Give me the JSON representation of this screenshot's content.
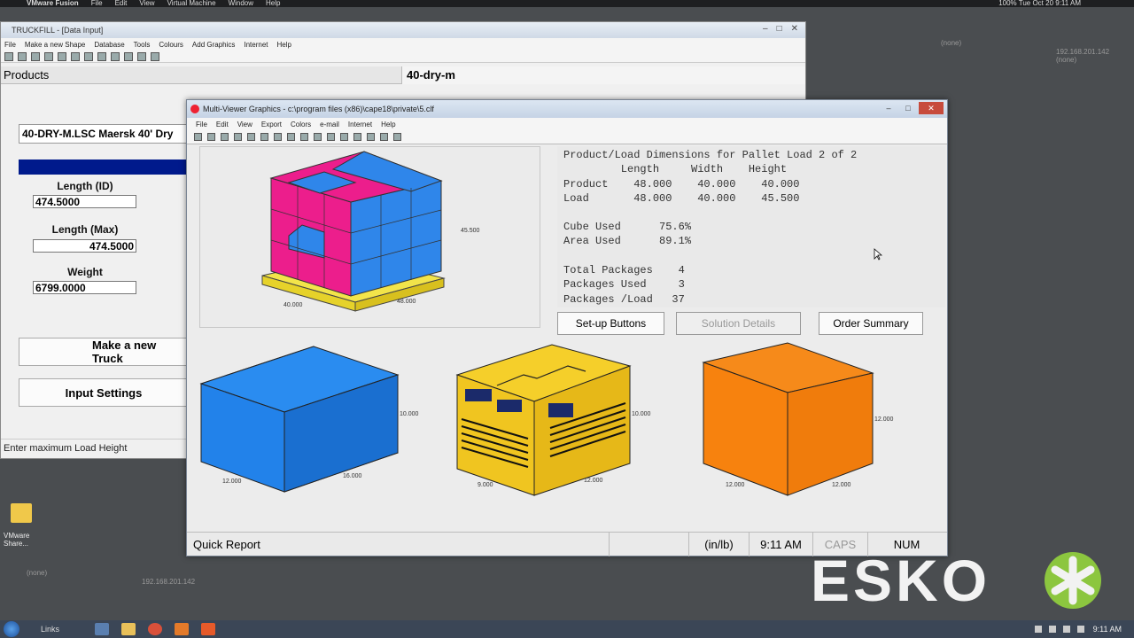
{
  "mac_menubar": {
    "app": "VMware Fusion",
    "items": [
      "File",
      "Edit",
      "View",
      "Virtual Machine",
      "Window",
      "Help"
    ],
    "right": "100%  Tue Oct 20  9:11 AM"
  },
  "desktop": {
    "labels": [
      "(none)",
      "192.168.201.142",
      "(none)",
      "192.168.201.142",
      "(none)"
    ],
    "icon_label_1": "VMware",
    "icon_label_2": "Share..."
  },
  "truckfill": {
    "title": "TRUCKFILL - [Data Input]",
    "menu": [
      "File",
      "Make a new Shape",
      "Database",
      "Tools",
      "Colours",
      "Add Graphics",
      "Internet",
      "Help"
    ],
    "header_products": "Products",
    "header_load": "40-dry-m",
    "product_name": "40-DRY-M.LSC Maersk 40' Dry",
    "length_id_label": "Length (ID)",
    "length_id_value": "474.5000",
    "length_max_label": "Length (Max)",
    "length_max_value": "474.5000",
    "weight_label": "Weight",
    "weight_value": "6799.0000",
    "make_new_button": "Make a new Truck",
    "input_settings_button": "Input Settings",
    "status": "Enter maximum Load Height"
  },
  "multiviewer": {
    "title": "Multi-Viewer Graphics - c:\\program files (x86)\\cape18\\private\\5.clf",
    "menu": [
      "File",
      "Edit",
      "View",
      "Export",
      "Colors",
      "e-mail",
      "Internet",
      "Help"
    ],
    "pallet_labels": {
      "height": "45.500",
      "left": "40.000",
      "right": "48.000"
    },
    "dims": {
      "heading": "Product/Load Dimensions for Pallet Load 2 of 2",
      "col_headers": "         Length     Width    Height",
      "product_row": "Product    48.000    40.000    40.000",
      "load_row": "Load       48.000    40.000    45.500",
      "cube_used": "Cube Used      75.6%",
      "area_used": "Area Used      89.1%",
      "total_packages": "Total Packages    4",
      "packages_used": "Packages Used     3",
      "packages_load": "Packages /Load   37"
    },
    "buttons": {
      "setup": "Set-up Buttons",
      "solution": "Solution Details",
      "order": "Order Summary"
    },
    "box1_labels": {
      "height": "10.000",
      "left": "12.000",
      "right": "16.000"
    },
    "box2_labels": {
      "height": "10.000",
      "left": "9.000",
      "right": "12.000"
    },
    "box3_labels": {
      "height": "12.000",
      "left": "12.000",
      "right": "12.000"
    },
    "status": {
      "report": "Quick Report",
      "units": "(in/lb)",
      "time": "9:11 AM",
      "caps": "CAPS",
      "num": "NUM"
    }
  },
  "taskbar": {
    "links": "Links",
    "clock": "9:11 AM"
  },
  "brand": "ESKO"
}
